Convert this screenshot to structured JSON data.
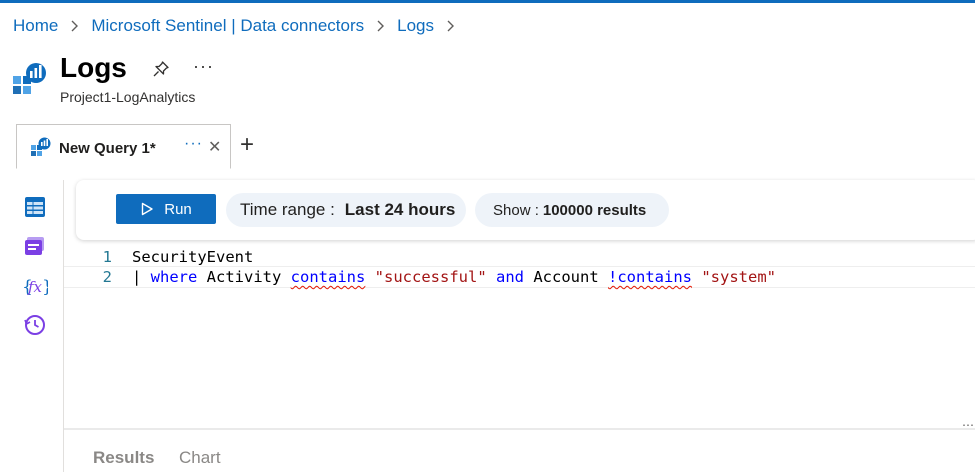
{
  "breadcrumb": {
    "items": [
      "Home",
      "Microsoft Sentinel | Data connectors",
      "Logs"
    ]
  },
  "header": {
    "title": "Logs",
    "subtitle": "Project1-LogAnalytics",
    "more": "···"
  },
  "tabs": {
    "active_label": "New Query 1*",
    "more": "···",
    "close": "✕",
    "add": "+"
  },
  "toolbar": {
    "run_label": "Run",
    "time_range_label": "Time range :",
    "time_range_value": "Last 24 hours",
    "show_label": "Show :",
    "show_value": "100000 results"
  },
  "editor": {
    "lines": [
      {
        "number": "1",
        "text": "SecurityEvent"
      },
      {
        "number": "2",
        "text": "| where Activity contains \"successful\" and Account !contains \"system\""
      }
    ],
    "tokens_line2": {
      "pipe": "| ",
      "where": "where",
      "sp1": " Activity ",
      "contains": "contains",
      "sp2": " ",
      "str1": "\"successful\"",
      "sp3": " ",
      "and": "and",
      "sp4": " Account ",
      "notcontains": "!contains",
      "sp5": " ",
      "str2": "\"system\""
    }
  },
  "results_tabs": [
    "Results",
    "Chart"
  ],
  "colors": {
    "accent": "#0f6cbd",
    "keyword": "#0000ff",
    "string": "#a31515",
    "line_number": "#237893"
  },
  "icons": [
    "log-analytics-icon",
    "pin-icon",
    "more-icon",
    "query-tab-icon",
    "close-icon",
    "add-icon",
    "run-icon",
    "tables-icon",
    "queries-icon",
    "functions-icon",
    "history-icon"
  ]
}
